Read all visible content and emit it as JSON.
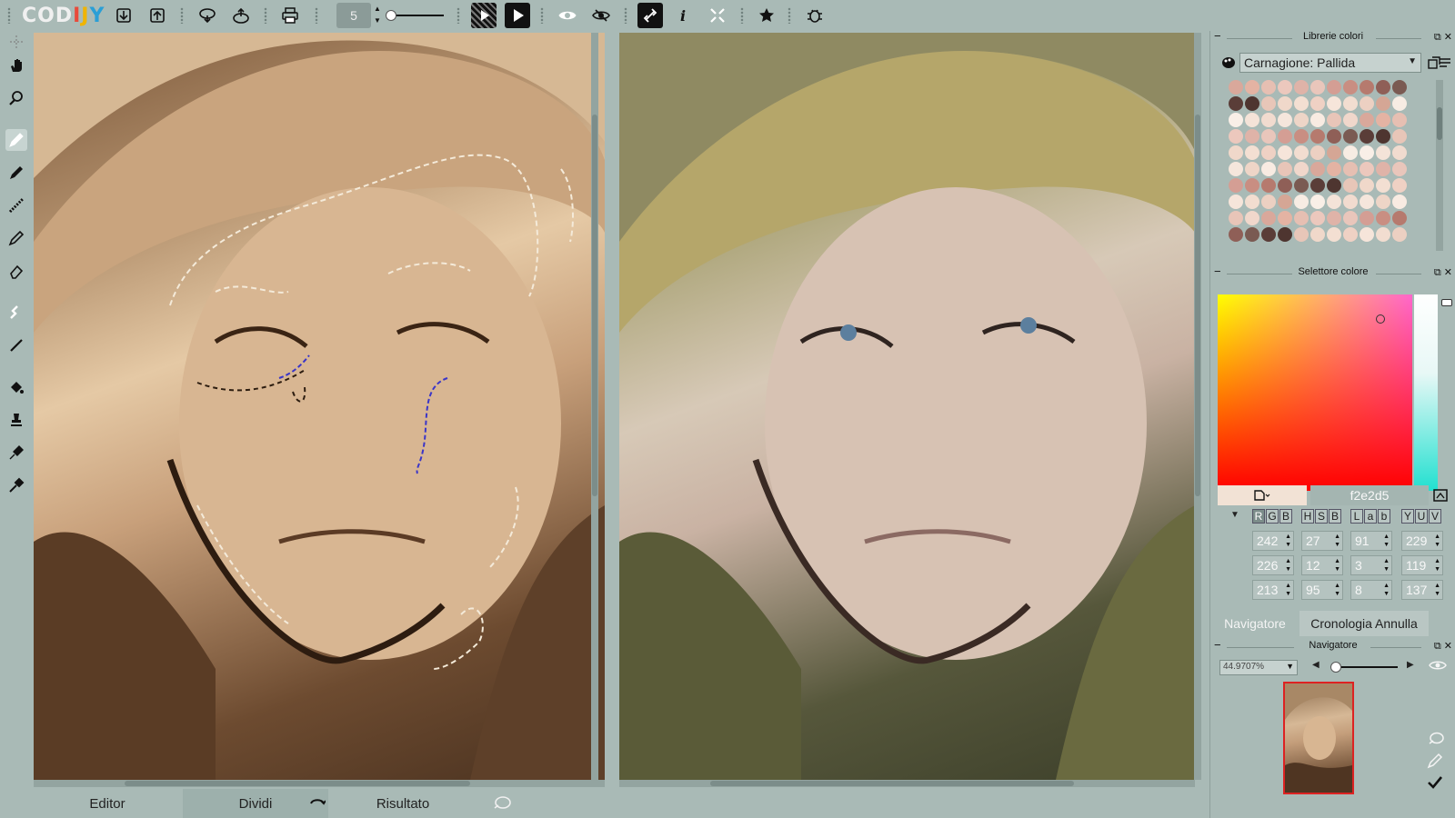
{
  "app": {
    "logo": "CODIJY"
  },
  "toolbar": {
    "brush_size": "5"
  },
  "bottom_tabs": {
    "editor": "Editor",
    "split": "Dividi",
    "result": "Risultato"
  },
  "color_library": {
    "title": "Librerie colori",
    "selected": "Carnagione: Pallida",
    "swatch_colors": [
      "#d9a89b",
      "#e4b3a3",
      "#e6bfb2",
      "#ecc8bd",
      "#dfb3a8",
      "#e9c6bb",
      "#d49e94",
      "#c98e82",
      "#b67a6e",
      "#8f5f57",
      "#7a5a52",
      "#5a3d38",
      "#4e3530",
      "#e8c6b8",
      "#f0d8ca",
      "#f3dfd2",
      "#efd1c4",
      "#f6e5da",
      "#f2ddd0",
      "#ecd0c2",
      "#d5a695",
      "#f7ece3",
      "#f9efe7",
      "#f4e3d8",
      "#f1dbcf",
      "#f5e6dc",
      "#eed5c7",
      "#f8ebe2",
      "#e8c5b8",
      "#f0d7cb"
    ]
  },
  "color_picker": {
    "title": "Selettore colore",
    "hex": "f2e2d5",
    "current_color": "#f2e2d5",
    "modes": [
      [
        "R",
        "G",
        "B"
      ],
      [
        "H",
        "S",
        "B"
      ],
      [
        "L",
        "a",
        "b"
      ],
      [
        "Y",
        "U",
        "V"
      ]
    ],
    "rows": [
      [
        "242",
        "27",
        "91",
        "229"
      ],
      [
        "226",
        "12",
        "3",
        "119"
      ],
      [
        "213",
        "95",
        "8",
        "137"
      ]
    ]
  },
  "panel_tabs": {
    "navigator": "Navigatore",
    "history": "Cronologia Annulla"
  },
  "navigator": {
    "title": "Navigatore",
    "zoom": "44.9707%"
  }
}
